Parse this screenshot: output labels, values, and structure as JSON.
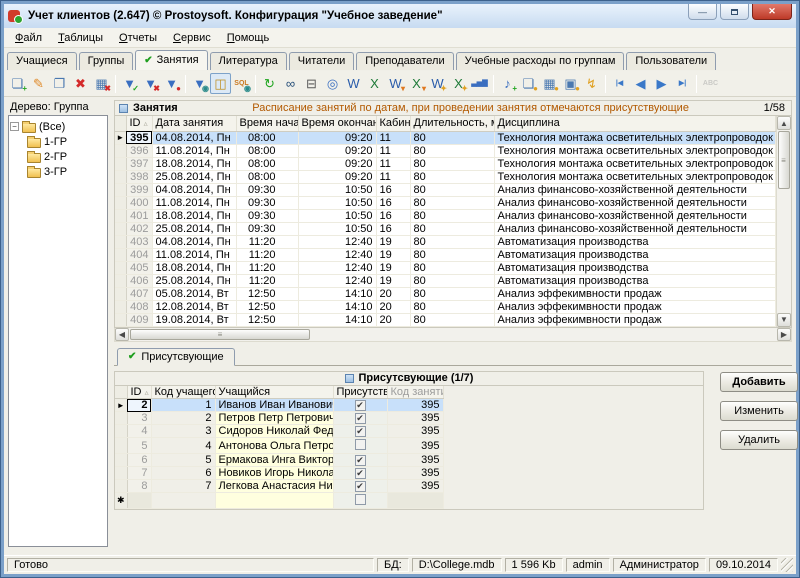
{
  "window": {
    "title": "Учет клиентов (2.647) © Prostoysoft. Конфигурация \"Учебное заведение\"",
    "controls": {
      "minimize": "minimize-button",
      "maximize": "maximize-button",
      "close_glyph": "✕",
      "min_glyph": "—"
    }
  },
  "menu": {
    "items": [
      "Файл",
      "Таблицы",
      "Отчеты",
      "Сервис",
      "Помощь"
    ]
  },
  "tabs": {
    "items": [
      "Учащиеся",
      "Группы",
      "Занятия",
      "Литература",
      "Читатели",
      "Преподаватели",
      "Учебные расходы по группам",
      "Пользователи"
    ],
    "active_index": 2,
    "check_glyph": "✔"
  },
  "toolbar": {
    "icons": [
      {
        "name": "add-record-icon",
        "glyph": "❏",
        "color": "#4a78b0",
        "badge": "+",
        "badge_color": "#1fa51f"
      },
      {
        "name": "edit-record-icon",
        "glyph": "✎",
        "color": "#e08a2a"
      },
      {
        "name": "copy-record-icon",
        "glyph": "❐",
        "color": "#4a78b0"
      },
      {
        "name": "delete-record-icon",
        "glyph": "✖",
        "color": "#d42a2a"
      },
      {
        "name": "clear-table-icon",
        "glyph": "▦",
        "color": "#4a78b0",
        "badge": "✖",
        "badge_color": "#d42a2a"
      },
      {
        "sep": true
      },
      {
        "name": "filter-apply-icon",
        "glyph": "▼",
        "color": "#3a6ec0",
        "badge": "✓",
        "badge_color": "#1fa51f"
      },
      {
        "name": "filter-clear-icon",
        "glyph": "▼",
        "color": "#3a6ec0",
        "badge": "✖",
        "badge_color": "#d42a2a"
      },
      {
        "name": "filter-remove-icon",
        "glyph": "▼",
        "color": "#3a6ec0",
        "badge": "●",
        "badge_color": "#d42a2a"
      },
      {
        "sep": true
      },
      {
        "name": "filter-view-icon",
        "glyph": "▼",
        "color": "#3a6ec0",
        "badge": "◉",
        "badge_color": "#2a8a8a"
      },
      {
        "name": "tree-panel-icon",
        "glyph": "◫",
        "color": "#c09020",
        "pressed": true
      },
      {
        "name": "sql-view-icon",
        "glyph": "SQL",
        "color": "#c87820",
        "small": true,
        "badge": "◉",
        "badge_color": "#2a8a8a"
      },
      {
        "sep": true
      },
      {
        "name": "refresh-icon",
        "glyph": "↻",
        "color": "#1fa51f"
      },
      {
        "name": "find-icon",
        "glyph": "∞",
        "color": "#28507a"
      },
      {
        "name": "print-icon",
        "glyph": "⊟",
        "color": "#5a5a5a"
      },
      {
        "name": "preview-icon",
        "glyph": "◎",
        "color": "#3a6ec0"
      },
      {
        "name": "export-word-icon",
        "glyph": "W",
        "color": "#2a5caa"
      },
      {
        "name": "export-excel-icon",
        "glyph": "X",
        "color": "#1e7a38"
      },
      {
        "name": "export-word-arrow-icon",
        "glyph": "W",
        "color": "#2a5caa",
        "badge": "▾",
        "badge_color": "#e07820"
      },
      {
        "name": "export-excel-arrow-icon",
        "glyph": "X",
        "color": "#1e7a38",
        "badge": "▾",
        "badge_color": "#e07820"
      },
      {
        "name": "export-word-template-icon",
        "glyph": "W",
        "color": "#2a5caa",
        "badge": "✦",
        "badge_color": "#e0a020"
      },
      {
        "name": "export-excel-template-icon",
        "glyph": "X",
        "color": "#1e7a38",
        "badge": "✦",
        "badge_color": "#e0a020"
      },
      {
        "name": "chart-icon",
        "glyph": "▃▅▇",
        "color": "#3a6ec0",
        "small": true
      },
      {
        "sep": true
      },
      {
        "name": "note-add-icon",
        "glyph": "♪",
        "color": "#3a6ec0",
        "badge": "+",
        "badge_color": "#1fa51f"
      },
      {
        "name": "page-sum-icon",
        "glyph": "❏",
        "color": "#4a78b0",
        "badge": "●",
        "badge_color": "#e0a020"
      },
      {
        "name": "table-sum-icon",
        "glyph": "▦",
        "color": "#4a78b0",
        "badge": "●",
        "badge_color": "#e0a020"
      },
      {
        "name": "form-sum-icon",
        "glyph": "▣",
        "color": "#4a78b0",
        "badge": "●",
        "badge_color": "#e0a020"
      },
      {
        "name": "autocalc-icon",
        "glyph": "↯",
        "color": "#e0a020"
      },
      {
        "sep": true
      },
      {
        "name": "nav-first-icon",
        "glyph": "|◀",
        "color": "#3a78c8",
        "small": true
      },
      {
        "name": "nav-prev-icon",
        "glyph": "◀",
        "color": "#3a78c8"
      },
      {
        "name": "nav-next-icon",
        "glyph": "▶",
        "color": "#3a78c8"
      },
      {
        "name": "nav-last-icon",
        "glyph": "▶|",
        "color": "#3a78c8",
        "small": true
      },
      {
        "sep": true
      },
      {
        "name": "spellcheck-icon",
        "glyph": "ABC",
        "color": "#9a9a9a",
        "small": true,
        "disabled": true
      }
    ]
  },
  "tree": {
    "label": "Дерево: Группа",
    "root": "(Все)",
    "root_expander": "−",
    "children": [
      "1-ГР",
      "2-ГР",
      "3-ГР"
    ]
  },
  "lessons": {
    "title": "Занятия",
    "description": "Расписание занятий по датам, при проведении занятия отмечаются присутствующие",
    "counter": "1/58",
    "columns": [
      "ID",
      "Дата занятия",
      "Время начала",
      "Время окончания",
      "Кабинет",
      "Длительность, мин.",
      "Дисциплина"
    ],
    "sort_glyph": "▵",
    "row_marker": "►",
    "rows": [
      {
        "id": 395,
        "date": "04.08.2014, Пн",
        "start": "08:00",
        "end": "09:20",
        "room": 11,
        "dur": 80,
        "disc": "Технология монтажа осветительных электропроводок и оборудования",
        "sel": true
      },
      {
        "id": 396,
        "date": "11.08.2014, Пн",
        "start": "08:00",
        "end": "09:20",
        "room": 11,
        "dur": 80,
        "disc": "Технология монтажа осветительных электропроводок и оборудования"
      },
      {
        "id": 397,
        "date": "18.08.2014, Пн",
        "start": "08:00",
        "end": "09:20",
        "room": 11,
        "dur": 80,
        "disc": "Технология монтажа осветительных электропроводок и оборудования"
      },
      {
        "id": 398,
        "date": "25.08.2014, Пн",
        "start": "08:00",
        "end": "09:20",
        "room": 11,
        "dur": 80,
        "disc": "Технология монтажа осветительных электропроводок и оборудования"
      },
      {
        "id": 399,
        "date": "04.08.2014, Пн",
        "start": "09:30",
        "end": "10:50",
        "room": 16,
        "dur": 80,
        "disc": "Анализ финансово-хозяйственной деятельности"
      },
      {
        "id": 400,
        "date": "11.08.2014, Пн",
        "start": "09:30",
        "end": "10:50",
        "room": 16,
        "dur": 80,
        "disc": "Анализ финансово-хозяйственной деятельности"
      },
      {
        "id": 401,
        "date": "18.08.2014, Пн",
        "start": "09:30",
        "end": "10:50",
        "room": 16,
        "dur": 80,
        "disc": "Анализ финансово-хозяйственной деятельности"
      },
      {
        "id": 402,
        "date": "25.08.2014, Пн",
        "start": "09:30",
        "end": "10:50",
        "room": 16,
        "dur": 80,
        "disc": "Анализ финансово-хозяйственной деятельности"
      },
      {
        "id": 403,
        "date": "04.08.2014, Пн",
        "start": "11:20",
        "end": "12:40",
        "room": 19,
        "dur": 80,
        "disc": "Автоматизация производства"
      },
      {
        "id": 404,
        "date": "11.08.2014, Пн",
        "start": "11:20",
        "end": "12:40",
        "room": 19,
        "dur": 80,
        "disc": "Автоматизация производства"
      },
      {
        "id": 405,
        "date": "18.08.2014, Пн",
        "start": "11:20",
        "end": "12:40",
        "room": 19,
        "dur": 80,
        "disc": "Автоматизация производства"
      },
      {
        "id": 406,
        "date": "25.08.2014, Пн",
        "start": "11:20",
        "end": "12:40",
        "room": 19,
        "dur": 80,
        "disc": "Автоматизация производства"
      },
      {
        "id": 407,
        "date": "05.08.2014, Вт",
        "start": "12:50",
        "end": "14:10",
        "room": 20,
        "dur": 80,
        "disc": "Анализ эффекимвности продаж"
      },
      {
        "id": 408,
        "date": "12.08.2014, Вт",
        "start": "12:50",
        "end": "14:10",
        "room": 20,
        "dur": 80,
        "disc": "Анализ эффекимвности продаж"
      },
      {
        "id": 409,
        "date": "19.08.2014, Вт",
        "start": "12:50",
        "end": "14:10",
        "room": 20,
        "dur": 80,
        "disc": "Анализ эффекимвности продаж"
      }
    ]
  },
  "attendees": {
    "tab_label": "Присутсвующие",
    "tab_check": "✔",
    "header": "Присутсвующие (1/7)",
    "columns": [
      "ID",
      "Код учащегося",
      "Учащийся",
      "Присутствие",
      "Код занятия"
    ],
    "check_glyph": "✔",
    "new_row_glyph": "✱",
    "rows": [
      {
        "id": 2,
        "code": 1,
        "name": "Иванов Иван Иванович",
        "present": true,
        "lesson": 395,
        "sel": true
      },
      {
        "id": 3,
        "code": 2,
        "name": "Петров Петр Петрович",
        "present": true,
        "lesson": 395
      },
      {
        "id": 4,
        "code": 3,
        "name": "Сидоров Николай Федорович",
        "present": true,
        "lesson": 395
      },
      {
        "id": 5,
        "code": 4,
        "name": "Антонова Ольга Петровна",
        "present": false,
        "lesson": 395
      },
      {
        "id": 6,
        "code": 5,
        "name": "Ермакова Инга Викторовна",
        "present": true,
        "lesson": 395
      },
      {
        "id": 7,
        "code": 6,
        "name": "Новиков Игорь Николаевич",
        "present": true,
        "lesson": 395
      },
      {
        "id": 8,
        "code": 7,
        "name": "Легкова Анастасия Николаевна",
        "present": true,
        "lesson": 395
      }
    ]
  },
  "buttons": {
    "add": "Добавить",
    "edit": "Изменить",
    "delete": "Удалить"
  },
  "statusbar": {
    "status": "Готово",
    "db_label": "БД:",
    "db_path": "D:\\College.mdb",
    "db_size": "1 596 Kb",
    "user": "admin",
    "role": "Администратор",
    "date": "09.10.2014"
  }
}
